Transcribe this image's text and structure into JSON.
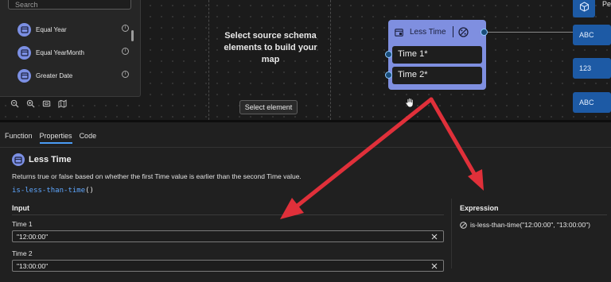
{
  "function_list": {
    "search_placeholder": "Search",
    "items": [
      {
        "label": "Equal Year",
        "icon": "calendar-icon"
      },
      {
        "label": "Equal YearMonth",
        "icon": "calendar-icon"
      },
      {
        "label": "Greater Date",
        "icon": "calendar-icon"
      }
    ],
    "info_glyph": "i",
    "toolbar": [
      "zoom-out-icon",
      "zoom-in-icon",
      "fit-view-icon",
      "map-icon"
    ]
  },
  "source_panel": {
    "message": "Select source schema elements to build your map",
    "button_label": "Select element"
  },
  "node": {
    "title": "Less Time",
    "inputs": [
      "Time 1*",
      "Time 2*"
    ],
    "accent": "#7f8fe0"
  },
  "target": {
    "header_label": "Pe",
    "cards": [
      "ABC",
      "123",
      "ABC"
    ],
    "accent": "#1d5aa5"
  },
  "properties": {
    "tabs": [
      {
        "label": "Function",
        "active": false
      },
      {
        "label": "Properties",
        "active": true
      },
      {
        "label": "Code",
        "active": false
      }
    ],
    "function_name": "Less Time",
    "description": "Returns true or false based on whether the first Time value is earlier than the second Time value.",
    "code_name": "is-less-than-time",
    "code_parens": "()",
    "input_heading": "Input",
    "fields": [
      {
        "label": "Time 1",
        "value": "\"12:00:00\""
      },
      {
        "label": "Time 2",
        "value": "\"13:00:00\""
      }
    ],
    "expression_heading": "Expression",
    "expression": "is-less-than-time(\"12:00:00\", \"13:00:00\")"
  },
  "annotation_color": "#e0303a"
}
